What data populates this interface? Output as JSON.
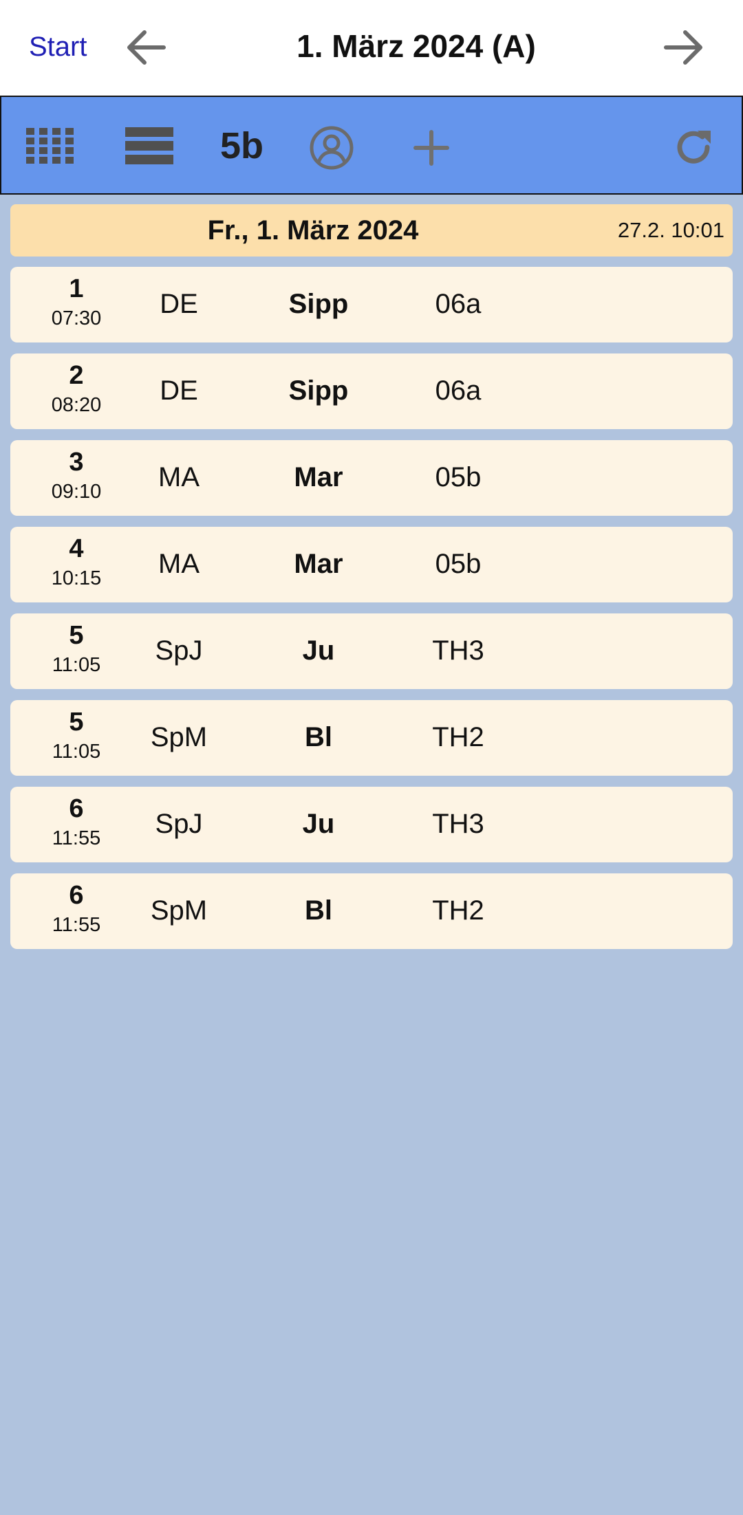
{
  "header": {
    "start_label": "Start",
    "title": "1. März 2024 (A)",
    "prev_icon": "arrow-left-icon",
    "next_icon": "arrow-right-icon"
  },
  "toolbar": {
    "class_label": "5b",
    "icons": [
      "grid-icon",
      "list-icon",
      "user-icon",
      "plus-icon",
      "refresh-icon"
    ],
    "background_color": "#6595ec"
  },
  "day": {
    "title": "Fr., 1. März 2024",
    "stamp": "27.2. 10:01",
    "header_color": "#fcdfab",
    "row_color": "#fdf4e4",
    "page_background": "#b0c3de"
  },
  "lessons": [
    {
      "period": "1",
      "time": "07:30",
      "subject": "DE",
      "teacher": "Sipp",
      "room": "06a"
    },
    {
      "period": "2",
      "time": "08:20",
      "subject": "DE",
      "teacher": "Sipp",
      "room": "06a"
    },
    {
      "period": "3",
      "time": "09:10",
      "subject": "MA",
      "teacher": "Mar",
      "room": "05b"
    },
    {
      "period": "4",
      "time": "10:15",
      "subject": "MA",
      "teacher": "Mar",
      "room": "05b"
    },
    {
      "period": "5",
      "time": "11:05",
      "subject": "SpJ",
      "teacher": "Ju",
      "room": "TH3"
    },
    {
      "period": "5",
      "time": "11:05",
      "subject": "SpM",
      "teacher": "Bl",
      "room": "TH2"
    },
    {
      "period": "6",
      "time": "11:55",
      "subject": "SpJ",
      "teacher": "Ju",
      "room": "TH3"
    },
    {
      "period": "6",
      "time": "11:55",
      "subject": "SpM",
      "teacher": "Bl",
      "room": "TH2"
    }
  ]
}
